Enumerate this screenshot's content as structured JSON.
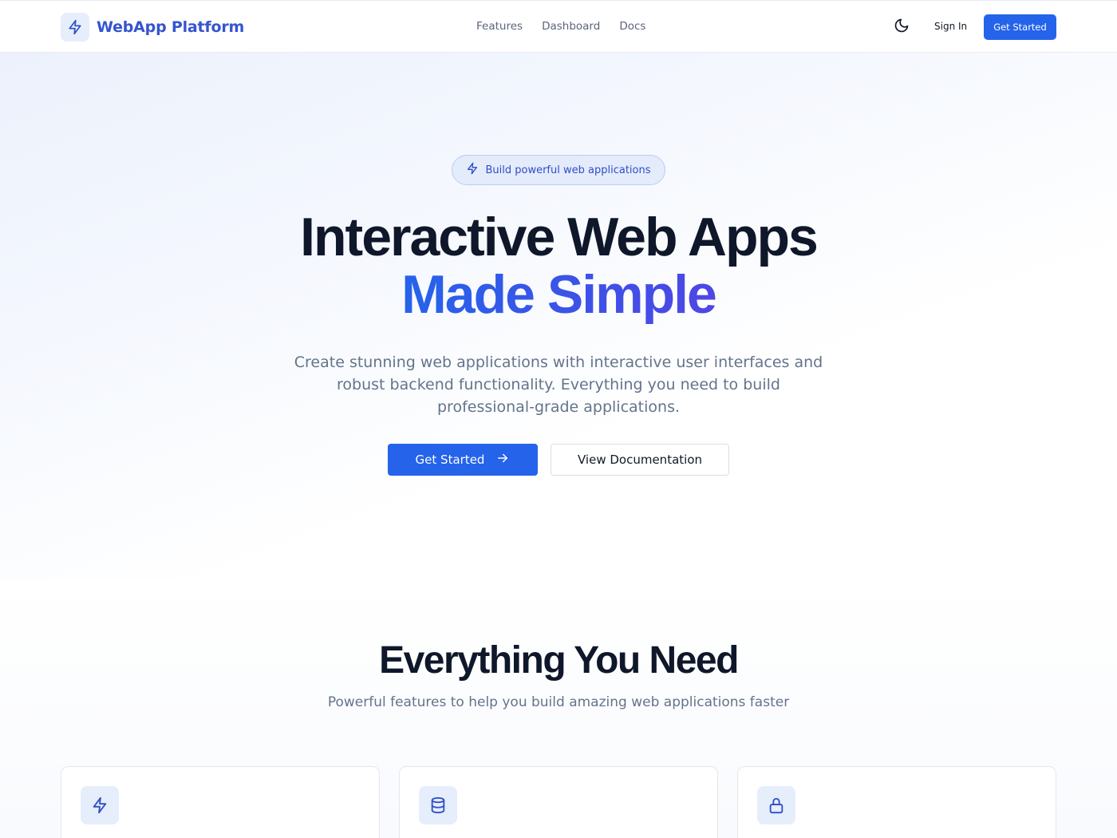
{
  "navbar": {
    "brand_name": "WebApp Platform",
    "brand_icon": "lightning-icon",
    "links": [
      "Features",
      "Dashboard",
      "Docs"
    ],
    "theme_toggle_icon": "moon-icon",
    "signin_label": "Sign In",
    "cta_label": "Get Started"
  },
  "hero": {
    "badge_icon": "lightning-icon",
    "badge_text": "Build powerful web applications",
    "title_line1": "Interactive Web Apps",
    "title_line2": "Made Simple",
    "subtitle": "Create stunning web applications with interactive user interfaces and robust backend functionality. Everything you need to build professional-grade applications.",
    "primary_button": "Get Started",
    "primary_button_icon": "arrow-right-icon",
    "secondary_button": "View Documentation"
  },
  "features": {
    "title": "Everything You Need",
    "subtitle": "Powerful features to help you build amazing web applications faster",
    "cards": [
      {
        "icon": "lightning-icon"
      },
      {
        "icon": "database-icon"
      },
      {
        "icon": "lock-icon"
      }
    ]
  },
  "colors": {
    "accent": "#2563eb",
    "brand_text": "#3554d1",
    "heading": "#0f172a",
    "muted_text": "#64748b",
    "icon_bg": "#e6edfb"
  }
}
